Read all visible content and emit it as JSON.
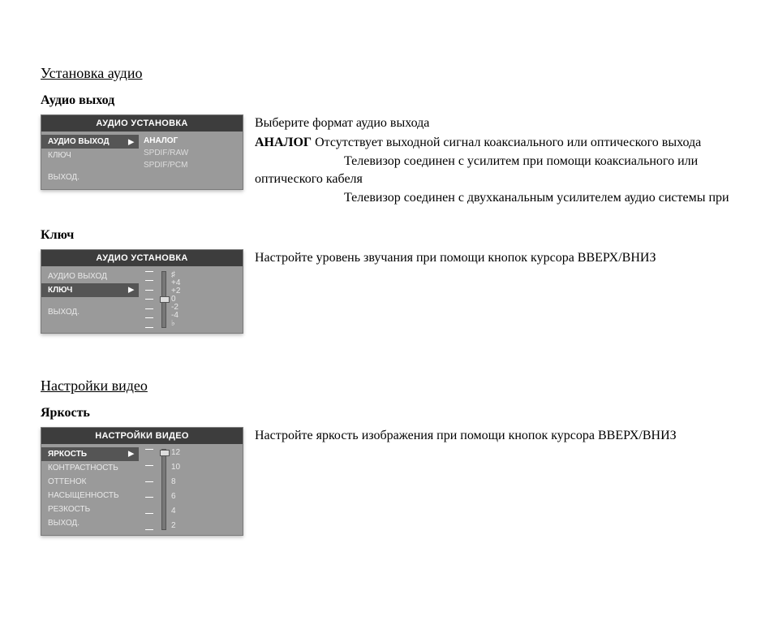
{
  "section1": {
    "title": "Установка аудио",
    "sub1": "Аудио выход",
    "osd1": {
      "header": "АУДИО УСТАНОВКА",
      "items": [
        "АУДИО ВЫХОД",
        "КЛЮЧ",
        "ВЫХОД."
      ],
      "values": [
        "АНАЛОГ",
        "SPDIF/RAW",
        "SPDIF/PCM"
      ]
    },
    "desc1_line1": "Выберите формат аудио выхода",
    "desc1_line2_bold": "АНАЛОГ",
    "desc1_line2_rest": "   Отсутствует выходной сигнал коаксиального или оптического выхода",
    "desc1_line3": "Телевизор соединен с усилитем при помощи коаксиального или оптического кабеля",
    "desc1_line4": "Телевизор соединен с двухканальным усилителем аудио системы при",
    "sub2": "Ключ",
    "osd2": {
      "header": "АУДИО УСТАНОВКА",
      "items": [
        "АУДИО ВЫХОД",
        "КЛЮЧ",
        "ВЫХОД."
      ],
      "scale": [
        "♯",
        "+4",
        "+2",
        "0",
        "-2",
        "-4",
        "♭"
      ]
    },
    "desc2": "Настройте уровень звучания при помощи кнопок курсора ВВЕРХ/ВНИЗ"
  },
  "section2": {
    "title": "Настройки видео",
    "sub1": "Яркость",
    "osd3": {
      "header": "НАСТРОЙКИ ВИДЕО",
      "items": [
        "ЯРКОСТЬ",
        "КОНТРАСТНОСТЬ",
        "ОТТЕНОК",
        "НАСЫЩЕННОСТЬ",
        "РЕЗКОСТЬ",
        "ВЫХОД."
      ],
      "scale": [
        "12",
        "10",
        "8",
        "6",
        "4",
        "2"
      ]
    },
    "desc1": "Настройте яркость изображения при помощи кнопок курсора ВВЕРХ/ВНИЗ"
  }
}
